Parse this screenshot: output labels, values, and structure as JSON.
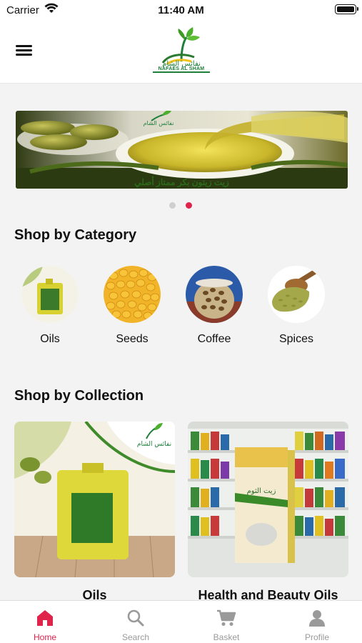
{
  "status_bar": {
    "carrier": "Carrier",
    "time": "11:40 AM"
  },
  "header": {
    "logo_text": "NAFAES AL SHAM"
  },
  "banner": {
    "slide_count": 2,
    "active_slide": 2
  },
  "categories": {
    "title": "Shop by Category",
    "items": [
      {
        "label": "Oils",
        "icon": "olive-oil-tin-image"
      },
      {
        "label": "Seeds",
        "icon": "corn-seeds-image"
      },
      {
        "label": "Coffee",
        "icon": "coffee-beans-jar-image"
      },
      {
        "label": "Spices",
        "icon": "fennel-scoop-image"
      }
    ]
  },
  "collections": {
    "title": "Shop by Collection",
    "items": [
      {
        "label": "Oils"
      },
      {
        "label": "Health and Beauty Oils"
      }
    ]
  },
  "tab_bar": {
    "items": [
      {
        "label": "Home",
        "icon": "home-icon",
        "active": true
      },
      {
        "label": "Search",
        "icon": "search-icon",
        "active": false
      },
      {
        "label": "Basket",
        "icon": "cart-icon",
        "active": false
      },
      {
        "label": "Profile",
        "icon": "profile-icon",
        "active": false
      }
    ]
  },
  "colors": {
    "accent": "#e0234b",
    "brand_green": "#1d7f3a"
  }
}
